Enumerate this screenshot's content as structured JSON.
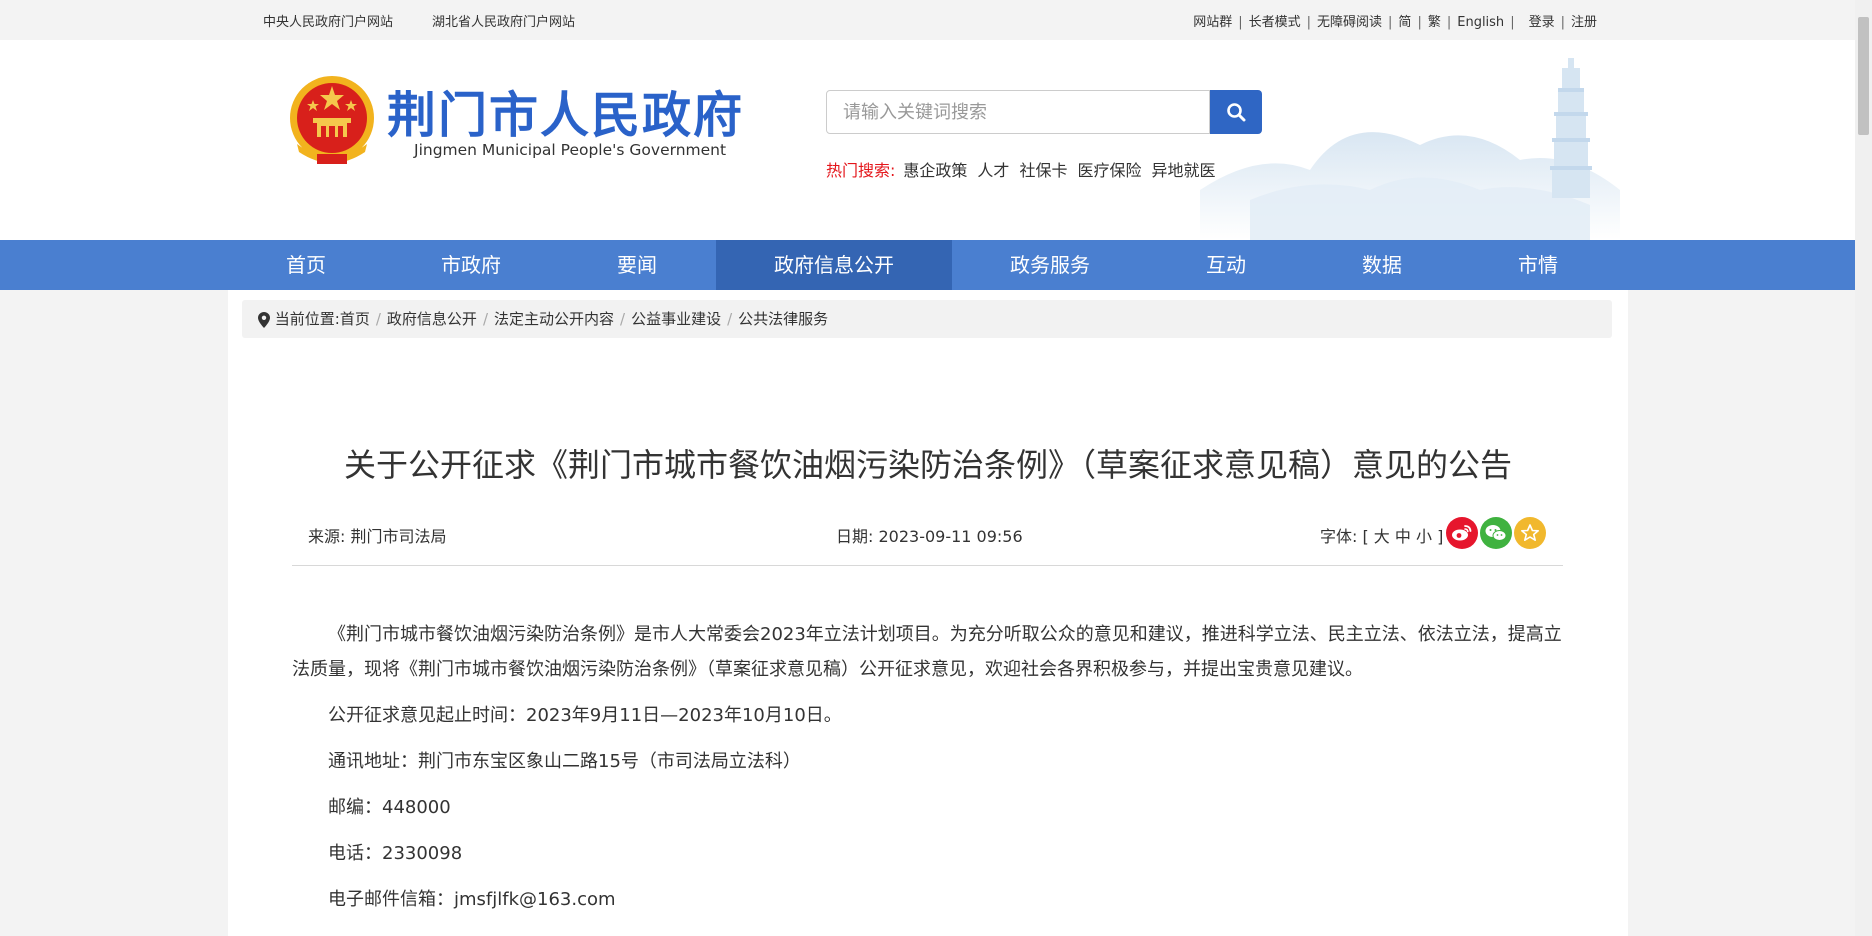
{
  "topbar": {
    "links": [
      "中央人民政府门户网站",
      "湖北省人民政府门户网站"
    ],
    "right_links": [
      "网站群",
      "长者模式",
      "无障碍阅读",
      "简",
      "繁",
      "English",
      "登录",
      "注册"
    ]
  },
  "header": {
    "title": "荆门市人民政府",
    "subtitle": "Jingmen Municipal People's Government",
    "search_placeholder": "请输入关键词搜索",
    "hot_label": "热门搜索:",
    "hot_items": [
      "惠企政策",
      "人才",
      "社保卡",
      "医疗保险",
      "异地就医"
    ]
  },
  "nav": {
    "items": [
      "首页",
      "市政府",
      "要闻",
      "政府信息公开",
      "政务服务",
      "互动",
      "数据",
      "市情"
    ],
    "active_index": 3
  },
  "breadcrumb": {
    "label": "当前位置:",
    "items": [
      "首页",
      "政府信息公开",
      "法定主动公开内容",
      "公益事业建设",
      "公共法律服务"
    ]
  },
  "article": {
    "title": "关于公开征求《荆门市城市餐饮油烟污染防治条例》（草案征求意见稿）意见的公告",
    "source": "来源: 荆门市司法局",
    "date": "日期: 2023-09-11 09:56",
    "font_label": "字体: [ 大 中 小 ]",
    "paragraphs": [
      "《荆门市城市餐饮油烟污染防治条例》是市人大常委会2023年立法计划项目。为充分听取公众的意见和建议，推进科学立法、民主立法、依法立法，提高立法质量，现将《荆门市城市餐饮油烟污染防治条例》（草案征求意见稿）公开征求意见，欢迎社会各界积极参与，并提出宝贵意见建议。",
      "公开征求意见起止时间：2023年9月11日—2023年10月10日。",
      "通讯地址：荆门市东宝区象山二路15号（市司法局立法科）",
      "邮编：448000",
      "电话：2330098",
      "电子邮件信箱：jmsfjlfk@163.com"
    ]
  },
  "share_icons": [
    "weibo-icon",
    "wechat-icon",
    "favorite-star-icon"
  ],
  "colors": {
    "brand_blue": "#2a62c9",
    "nav_blue": "#4a7fd0",
    "nav_active": "#3465b3",
    "hot_red": "#e4161b",
    "weibo": "#e6162d",
    "wechat": "#3fb23f",
    "favorite": "#f1b82d"
  }
}
